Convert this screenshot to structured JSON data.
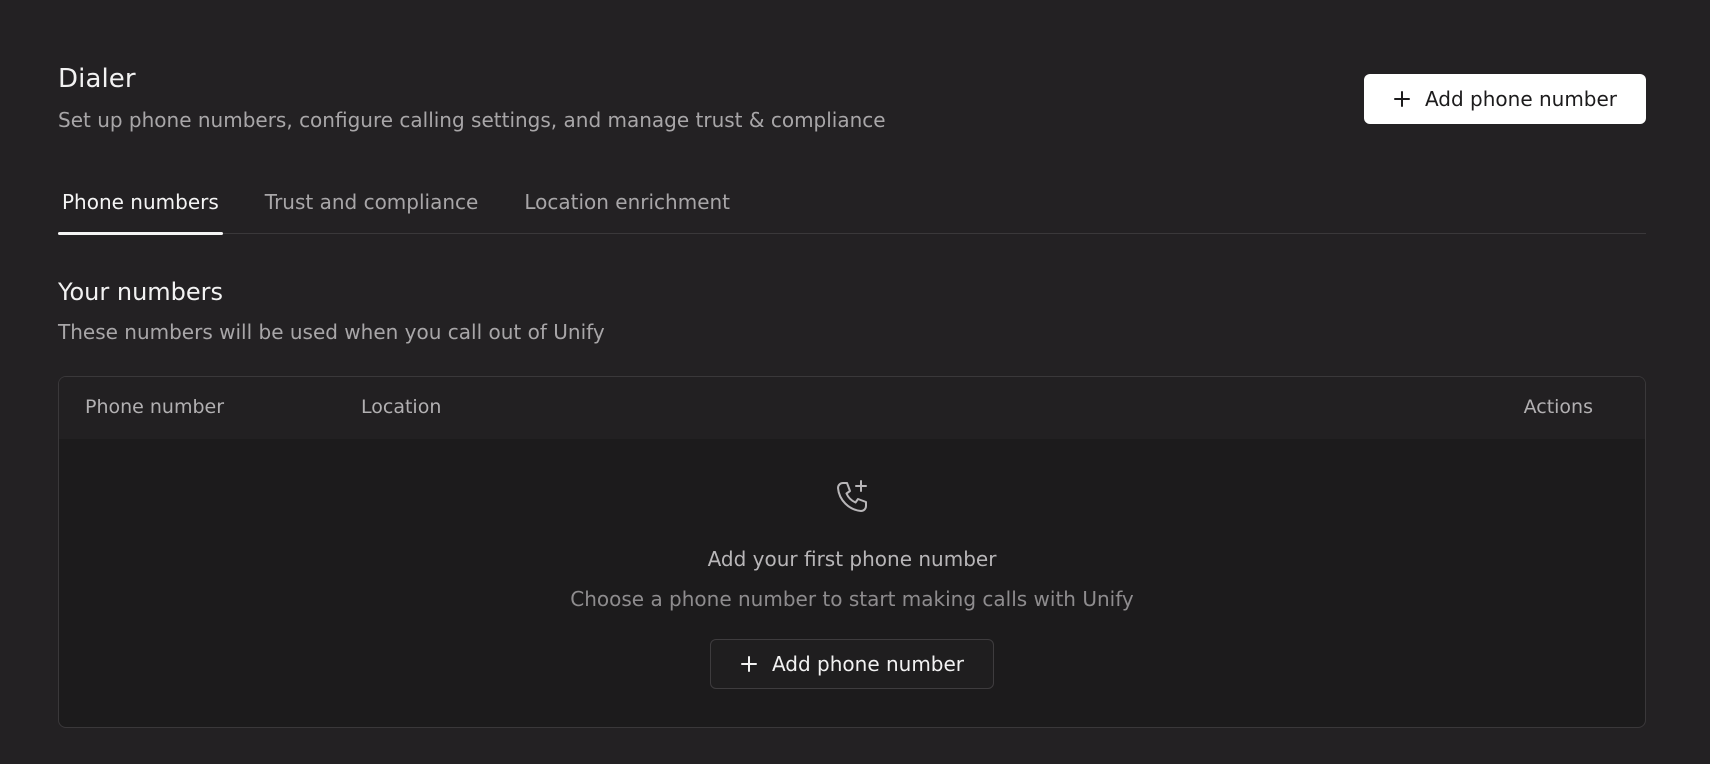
{
  "header": {
    "title": "Dialer",
    "subtitle": "Set up phone numbers, configure calling settings, and manage trust & compliance",
    "add_button_label": "Add phone number"
  },
  "tabs": [
    {
      "label": "Phone numbers",
      "active": true
    },
    {
      "label": "Trust and compliance",
      "active": false
    },
    {
      "label": "Location enrichment",
      "active": false
    }
  ],
  "section": {
    "title": "Your numbers",
    "subtitle": "These numbers will be used when you call out of Unify"
  },
  "table": {
    "columns": [
      "Phone number",
      "Location",
      "Actions"
    ],
    "empty_state": {
      "icon": "phone-plus-icon",
      "title": "Add your first phone number",
      "subtitle": "Choose a phone number to start making calls with Unify",
      "button_label": "Add phone number"
    }
  },
  "colors": {
    "background": "#232123",
    "primary_button": "#ffffff",
    "muted_text": "#a8a6a8"
  }
}
